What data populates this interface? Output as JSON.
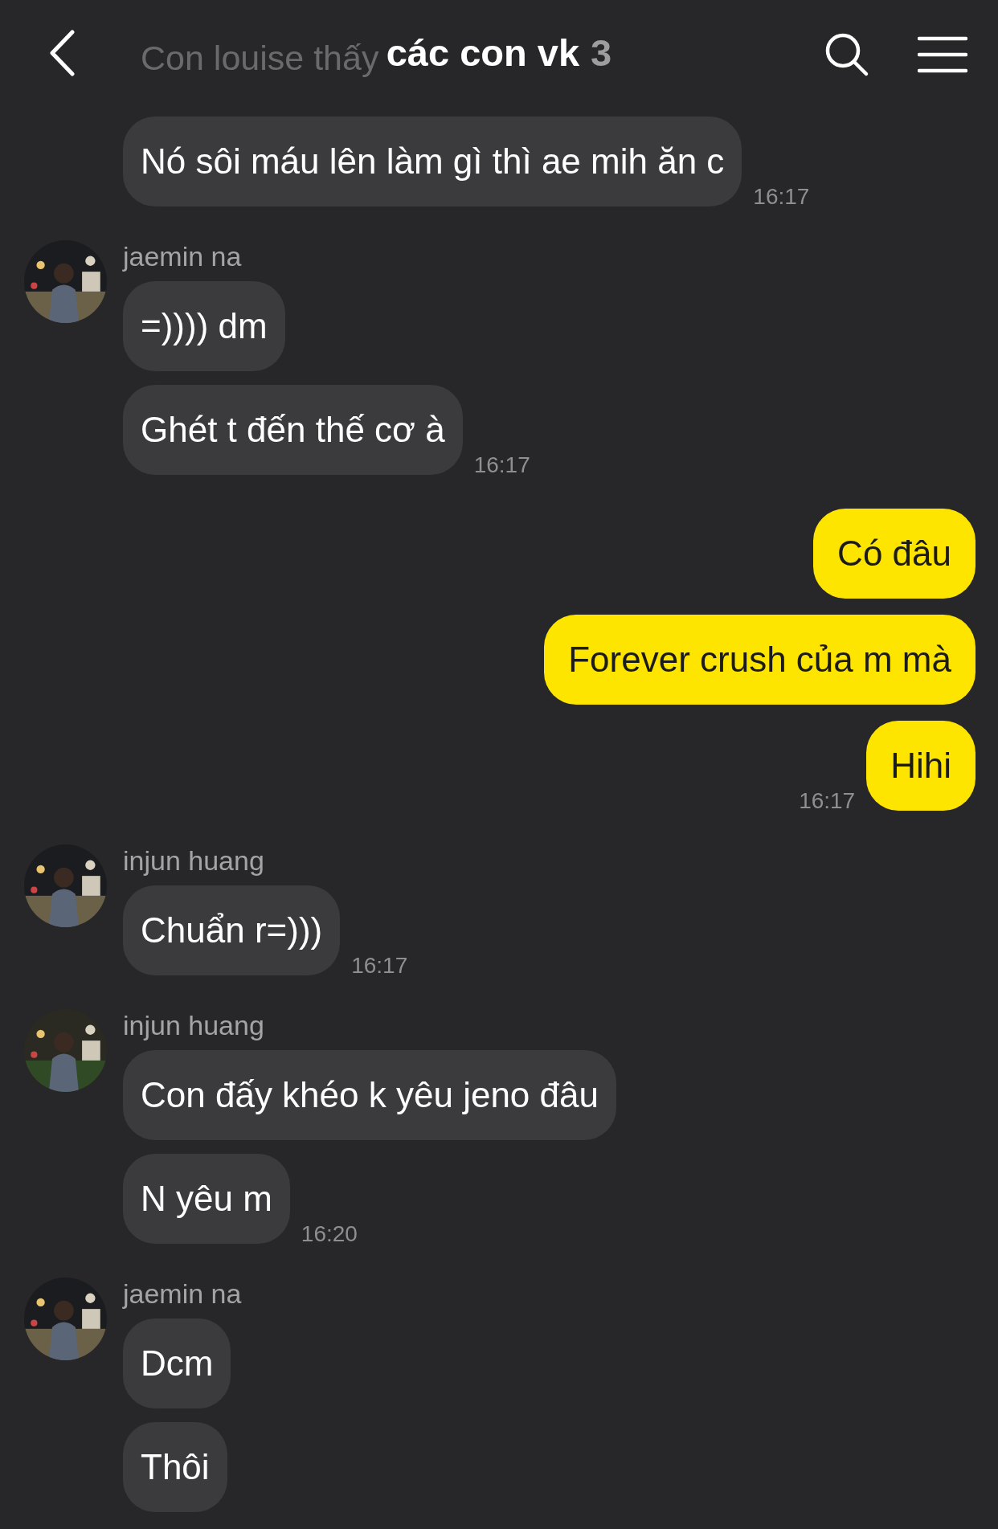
{
  "header": {
    "title": "các con vk",
    "member_count": "3",
    "behind_text": "Con louise thấy"
  },
  "groups": [
    {
      "kind": "received",
      "messages": [
        "Nó sôi máu lên làm gì thì ae mih ăn c"
      ],
      "time": "16:17"
    },
    {
      "kind": "received",
      "sender": "jaemin na",
      "messages": [
        "=)))) dm",
        "Ghét t đến thế cơ à"
      ],
      "time": "16:17"
    },
    {
      "kind": "sent",
      "messages": [
        "Có đâu",
        "Forever crush của m mà",
        "Hihi"
      ],
      "time": "16:17"
    },
    {
      "kind": "received",
      "sender": "injun huang",
      "messages": [
        "Chuẩn r=)))"
      ],
      "time": "16:17"
    },
    {
      "kind": "received",
      "sender": "injun huang",
      "messages": [
        "Con đấy khéo k yêu jeno đâu",
        "N yêu m"
      ],
      "time": "16:20"
    },
    {
      "kind": "received",
      "sender": "jaemin na",
      "messages": [
        "Dcm",
        "Thôi"
      ]
    }
  ]
}
